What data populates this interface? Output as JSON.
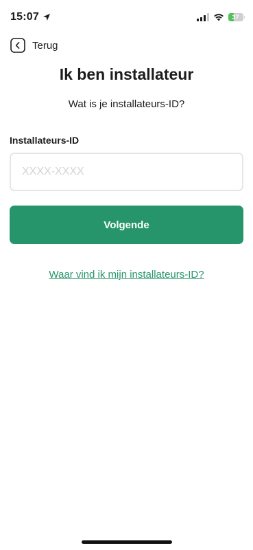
{
  "status_bar": {
    "time": "15:07",
    "location_icon": "location-arrow-icon",
    "signal_icon": "cellular-signal-icon",
    "wifi_icon": "wifi-icon",
    "battery_level": 37,
    "battery_text": "37"
  },
  "nav": {
    "back_label": "Terug",
    "back_icon": "chevron-left-icon"
  },
  "header": {
    "title": "Ik ben installateur",
    "subtitle": "Wat is je installateurs-ID?"
  },
  "form": {
    "field_label": "Installateurs-ID",
    "input_value": "",
    "input_placeholder": "XXXX-XXXX",
    "next_button_label": "Volgende"
  },
  "help": {
    "link_text": "Waar vind ik mijn installateurs-ID?"
  },
  "colors": {
    "accent": "#27956b",
    "input_border": "#e6e6e8",
    "battery_fill": "#54c05a"
  }
}
